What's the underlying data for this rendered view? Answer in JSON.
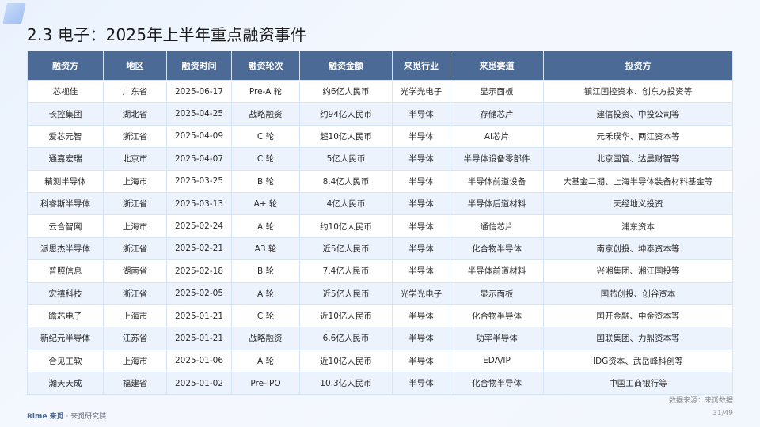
{
  "title": "2.3 电子：2025年上半年重点融资事件",
  "table": {
    "headers": [
      "融资方",
      "地区",
      "融资时间",
      "融资轮次",
      "融资金额",
      "来觅行业",
      "来觅赛道",
      "投资方"
    ],
    "rows": [
      [
        "芯视佳",
        "广东省",
        "2025-06-17",
        "Pre-A 轮",
        "约6亿人民币",
        "光学光电子",
        "显示面板",
        "镇江国控资本、创东方投资等"
      ],
      [
        "长控集团",
        "湖北省",
        "2025-04-25",
        "战略融资",
        "约94亿人民币",
        "半导体",
        "存储芯片",
        "建信投资、中投公司等"
      ],
      [
        "爱芯元智",
        "浙江省",
        "2025-04-09",
        "C 轮",
        "超10亿人民币",
        "半导体",
        "AI芯片",
        "元禾璞华、两江资本等"
      ],
      [
        "通嘉宏瑞",
        "北京市",
        "2025-04-07",
        "C 轮",
        "5亿人民币",
        "半导体",
        "半导体设备零部件",
        "北京国管、达晨财智等"
      ],
      [
        "精测半导体",
        "上海市",
        "2025-03-25",
        "B 轮",
        "8.4亿人民币",
        "半导体",
        "半导体前道设备",
        "大基金二期、上海半导体装备材料基金等"
      ],
      [
        "科睿斯半导体",
        "浙江省",
        "2025-03-13",
        "A+ 轮",
        "4亿人民币",
        "半导体",
        "半导体后道材料",
        "天经地义投资"
      ],
      [
        "云合智网",
        "上海市",
        "2025-02-24",
        "A 轮",
        "约10亿人民币",
        "半导体",
        "通信芯片",
        "浦东资本"
      ],
      [
        "派恩杰半导体",
        "浙江省",
        "2025-02-21",
        "A3 轮",
        "近5亿人民币",
        "半导体",
        "化合物半导体",
        "南京创投、坤泰资本等"
      ],
      [
        "普照信息",
        "湖南省",
        "2025-02-18",
        "B 轮",
        "7.4亿人民币",
        "半导体",
        "半导体前道材料",
        "兴湘集团、湘江国投等"
      ],
      [
        "宏禧科技",
        "浙江省",
        "2025-02-05",
        "A 轮",
        "近5亿人民币",
        "光学光电子",
        "显示面板",
        "国芯创投、创谷资本"
      ],
      [
        "瞻芯电子",
        "上海市",
        "2025-01-21",
        "C 轮",
        "近10亿人民币",
        "半导体",
        "化合物半导体",
        "国开金融、中金资本等"
      ],
      [
        "新纪元半导体",
        "江苏省",
        "2025-01-21",
        "战略融资",
        "6.6亿人民币",
        "半导体",
        "功率半导体",
        "国联集团、力鼎资本等"
      ],
      [
        "合见工软",
        "上海市",
        "2025-01-06",
        "A 轮",
        "近10亿人民币",
        "半导体",
        "EDA/IP",
        "IDG资本、武岳峰科创等"
      ],
      [
        "瀚天天成",
        "福建省",
        "2025-01-02",
        "Pre-IPO",
        "10.3亿人民币",
        "半导体",
        "化合物半导体",
        "中国工商银行等"
      ]
    ]
  },
  "source": "数据来源：来觅数据",
  "footer": {
    "brand": "Rime 来觅",
    "org": "· 来觅研究院"
  },
  "page": "31/49"
}
